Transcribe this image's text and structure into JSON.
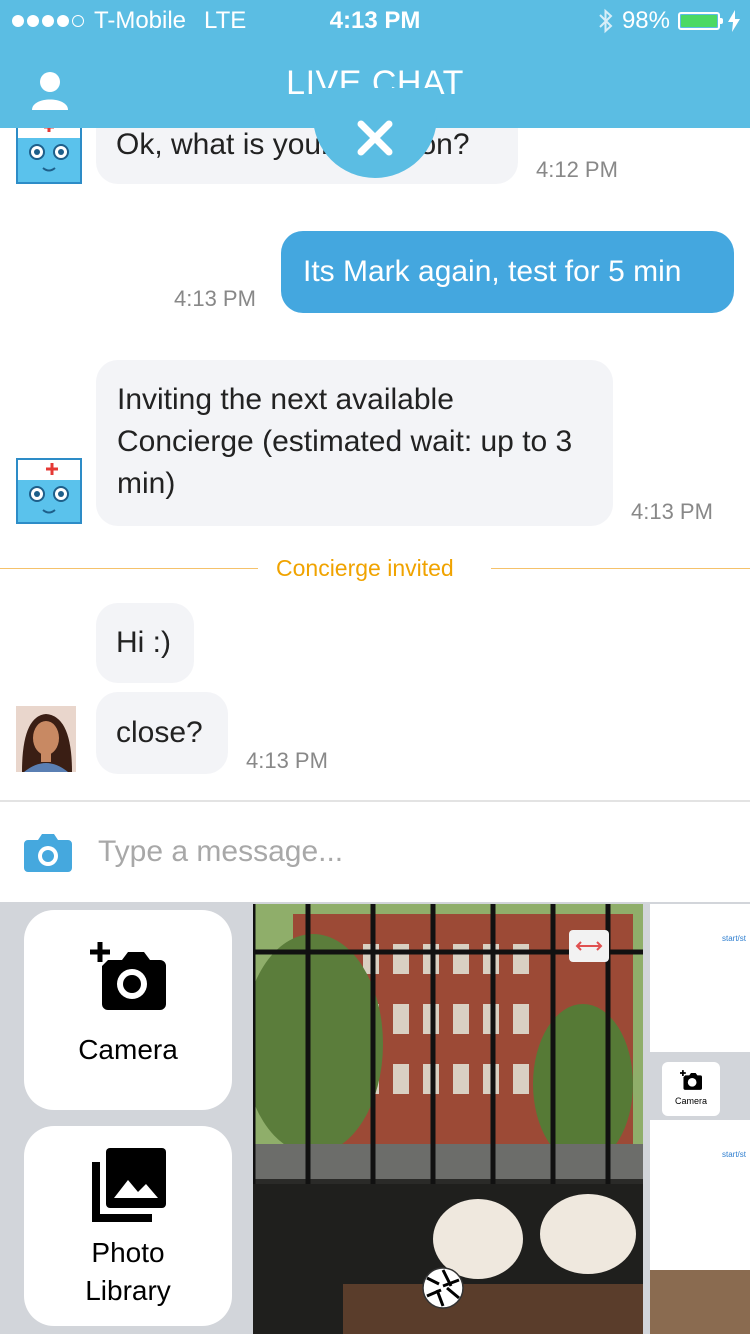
{
  "status_bar": {
    "carrier": "T-Mobile",
    "network": "LTE",
    "time": "4:13 PM",
    "battery": "98%"
  },
  "header": {
    "title": "LIVE CHAT"
  },
  "messages": {
    "m1": {
      "text": "Ok, what is your question?",
      "time": "4:12 PM"
    },
    "m2": {
      "text": "Its Mark again, test for 5 min",
      "time": "4:13 PM"
    },
    "m3": {
      "text": "Inviting the next available Concierge (estimated wait: up to 3 min)",
      "time": "4:13 PM"
    },
    "divider": "Concierge invited",
    "m4": {
      "text": "Hi :)"
    },
    "m5": {
      "text": "close?",
      "time": "4:13 PM"
    }
  },
  "composer": {
    "placeholder": "Type a message..."
  },
  "tray": {
    "camera_label": "Camera",
    "library_label": "Photo Library",
    "thumb_text": "start/st",
    "thumb_camera_label": "Camera"
  },
  "colors": {
    "brand": "#5bbde3",
    "outgoing_bubble": "#44a7df",
    "divider": "#f0a300"
  }
}
